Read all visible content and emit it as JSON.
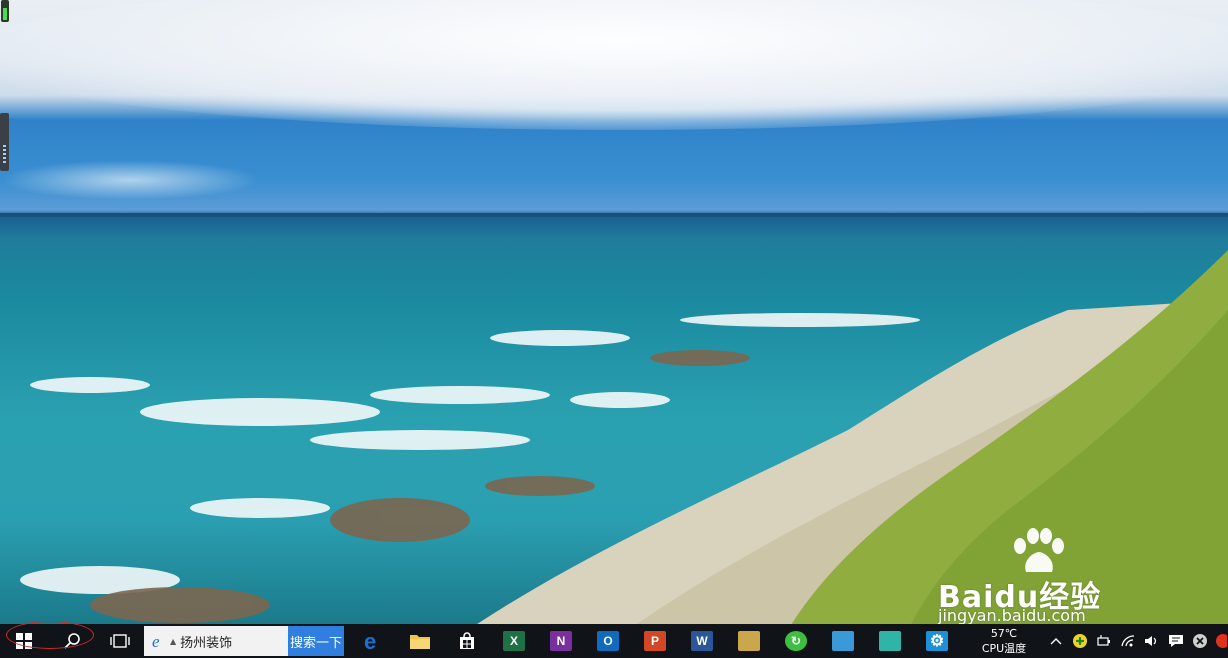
{
  "desktop": {
    "watermark": {
      "brand": "Baidu经验",
      "url": "jingyan.baidu.com"
    },
    "gauge_level": 0.65
  },
  "taskbar": {
    "start_icon": "windows-logo-icon",
    "search_icon": "search-icon",
    "task_view_icon": "task-view-icon",
    "search_box": {
      "value": "扬州装饰",
      "button_label": "搜索一下"
    },
    "apps": [
      {
        "name": "edge",
        "icon": "edge-icon",
        "color": "#1b6fd6"
      },
      {
        "name": "file-explorer",
        "icon": "folder-icon",
        "color": "#f2c14a"
      },
      {
        "name": "store",
        "icon": "store-icon",
        "color": "#ffffff"
      },
      {
        "name": "excel",
        "icon": "excel-icon",
        "color": "#1e7145",
        "letter": "X"
      },
      {
        "name": "onenote",
        "icon": "onenote-icon",
        "color": "#7a2f9e",
        "letter": "N"
      },
      {
        "name": "outlook",
        "icon": "outlook-icon",
        "color": "#0f6cbd",
        "letter": "O"
      },
      {
        "name": "powerpoint",
        "icon": "powerpoint-icon",
        "color": "#d24726",
        "letter": "P"
      },
      {
        "name": "word",
        "icon": "word-icon",
        "color": "#2b579a",
        "letter": "W"
      },
      {
        "name": "paint",
        "icon": "palette-icon",
        "color": "#c9a74a"
      },
      {
        "name": "browser-green",
        "icon": "green-refresh-icon",
        "color": "#3fbf3f"
      },
      {
        "name": "image-viewer",
        "icon": "image-icon",
        "color": "#3a9ad9"
      },
      {
        "name": "paint3d",
        "icon": "paint3d-icon",
        "color": "#2fb5a7"
      },
      {
        "name": "settings",
        "icon": "gear-icon",
        "color": "#1e90d6"
      }
    ],
    "temperature": {
      "value": "57℃",
      "label": "CPU温度"
    },
    "tray": [
      "chevron-up-icon",
      "plus-badge-icon",
      "battery-icon",
      "wifi-icon",
      "volume-icon",
      "notification-icon",
      "close-circle-icon",
      "app-tray-icon"
    ]
  }
}
